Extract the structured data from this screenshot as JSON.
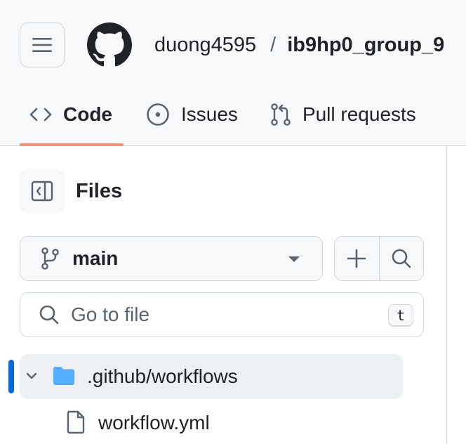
{
  "repo": {
    "owner": "duong4595",
    "separator": "/",
    "name": "ib9hp0_group_9"
  },
  "tabs": [
    {
      "label": "Code",
      "icon": "code-icon",
      "selected": true
    },
    {
      "label": "Issues",
      "icon": "issue-opened-icon",
      "selected": false
    },
    {
      "label": "Pull requests",
      "icon": "git-pull-request-icon",
      "selected": false
    }
  ],
  "file_panel": {
    "title": "Files",
    "branch": "main",
    "search_placeholder": "Go to file",
    "shortcut_key": "t"
  },
  "tree": [
    {
      "name": ".github/workflows",
      "type": "folder",
      "expanded": true,
      "selected": true
    },
    {
      "name": "workflow.yml",
      "type": "file"
    }
  ],
  "colors": {
    "header_bg": "#f6f8fa",
    "tab_underline": "#fd8c73",
    "selection_bar": "#0969da",
    "folder": "#54aeff"
  }
}
